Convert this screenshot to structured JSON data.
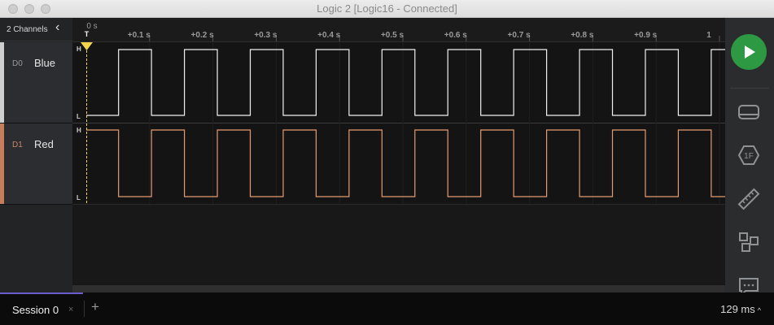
{
  "window": {
    "title": "Logic 2 [Logic16 - Connected]"
  },
  "channels_panel": {
    "count_label": "2 Channels",
    "collapse_glyph": "‹",
    "channels": [
      {
        "index": "D0",
        "name": "Blue",
        "color": "#d9d9d9",
        "index_color": "#9a9a9a",
        "stripe": "#cfcfcf"
      },
      {
        "index": "D1",
        "name": "Red",
        "color": "#e49a72",
        "index_color": "#c9866a",
        "stripe": "#c87c5a"
      }
    ]
  },
  "timeline": {
    "origin_label": "0 s",
    "ticks": [
      "+0.1 s",
      "+0.2 s",
      "+0.3 s",
      "+0.4 s",
      "+0.5 s",
      "+0.6 s",
      "+0.7 s",
      "+0.8 s",
      "+0.9 s",
      "1"
    ],
    "trigger_label": "T",
    "trigger_color": "#f2d54a",
    "level_high": "H",
    "level_low": "L"
  },
  "signals": {
    "D0": {
      "period_s": 0.104,
      "start_s": 0.051,
      "first_level": "low",
      "color": "#f0f0f0"
    },
    "D1": {
      "period_s": 0.104,
      "start_s": 0.051,
      "first_level": "high",
      "color": "#e49a72"
    }
  },
  "toolbar": {
    "play_color": "#2d9a43",
    "icons": [
      "record-icon",
      "digital-trigger-icon",
      "measure-icon",
      "extensions-icon",
      "annotation-icon"
    ]
  },
  "bottom": {
    "session_label": "Session 0",
    "session_close": "×",
    "add_tab": "+",
    "status": "129 ms",
    "status_caret": "^"
  }
}
